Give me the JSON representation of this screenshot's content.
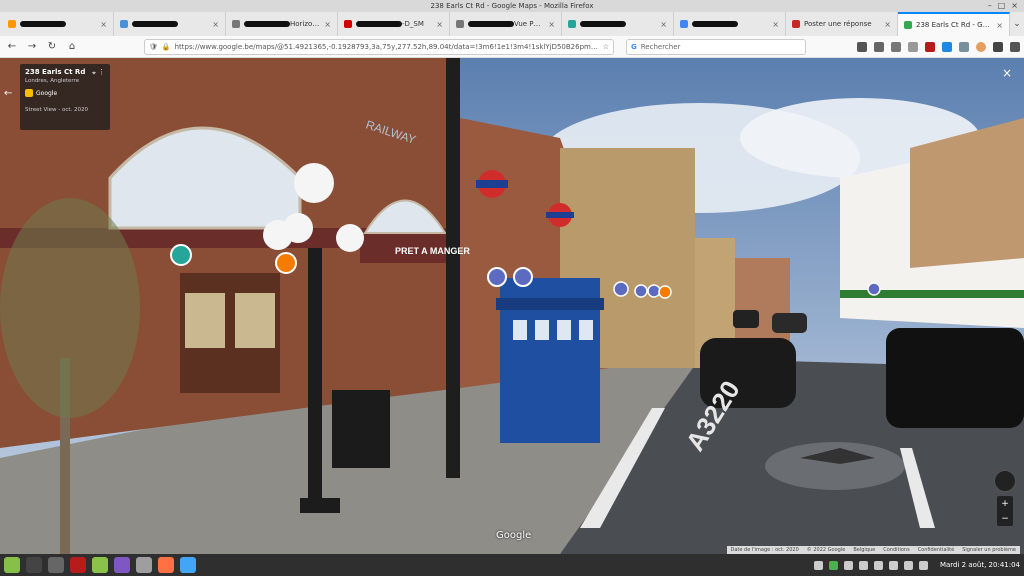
{
  "window": {
    "title": "238 Earls Ct Rd - Google Maps - Mozilla Firefox",
    "controls": [
      "–",
      "□",
      "×"
    ]
  },
  "tabs": [
    {
      "label": "",
      "color": "#ff9800",
      "redacted": true
    },
    {
      "label": "",
      "color": "#4a90d9",
      "redacted": true
    },
    {
      "label": "Horizons Em",
      "color": "#777777",
      "redacted": true
    },
    {
      "label": "-D_SM",
      "color": "#d50000",
      "redacted": true
    },
    {
      "label": "Vue PDF -",
      "color": "#777777",
      "redacted": true
    },
    {
      "label": "",
      "color": "#26a69a",
      "redacted": true
    },
    {
      "label": "",
      "color": "#4285f4",
      "redacted": true
    },
    {
      "label": "Poster une réponse",
      "color": "#c62828",
      "redacted": false
    },
    {
      "label": "238 Earls Ct Rd - Google",
      "color": "#34a853",
      "redacted": false,
      "active": true
    }
  ],
  "nav": {
    "back": "←",
    "forward": "→",
    "reload": "↻",
    "home": "⌂",
    "url": "https://www.google.be/maps/@51.4921365,-0.1928793,3a,75y,277.52h,89.04t/data=!3m6!1e1!3m4!1sklYjD50B26pmgLYq1",
    "search_placeholder": "Rechercher"
  },
  "streetview": {
    "place": "238 Earls Ct Rd",
    "subtitle": "Londres, Angleterre",
    "logo": "Google",
    "date_label": "Street View - oct. 2020",
    "watermark": "Google",
    "road_marking": "A3220",
    "pret_sign": "PRET A MANGER",
    "railway_sign": "RAILWAY",
    "close": "×",
    "zoom_in": "+",
    "zoom_out": "−",
    "attribution": [
      "Date de l'image : oct. 2020",
      "© 2022 Google",
      "Belgique",
      "Conditions",
      "Confidentialité",
      "Signaler un problème"
    ]
  },
  "taskbar": {
    "clock": "Mardi 2 août, 20:41:04"
  }
}
